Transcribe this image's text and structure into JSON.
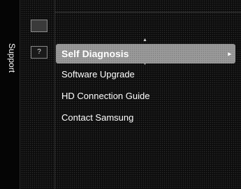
{
  "sidebar": {
    "label": "Support"
  },
  "icons": {
    "top": "picture-icon",
    "selected": "question-icon",
    "selected_text": "?"
  },
  "menu": {
    "items": [
      {
        "label": "Self Diagnosis",
        "selected": true,
        "has_submenu": true
      },
      {
        "label": "Software Upgrade"
      },
      {
        "label": "HD Connection Guide"
      },
      {
        "label": "Contact Samsung"
      }
    ],
    "chevron": "▸",
    "up_arrow": "▲",
    "down_arrow": "▼"
  }
}
